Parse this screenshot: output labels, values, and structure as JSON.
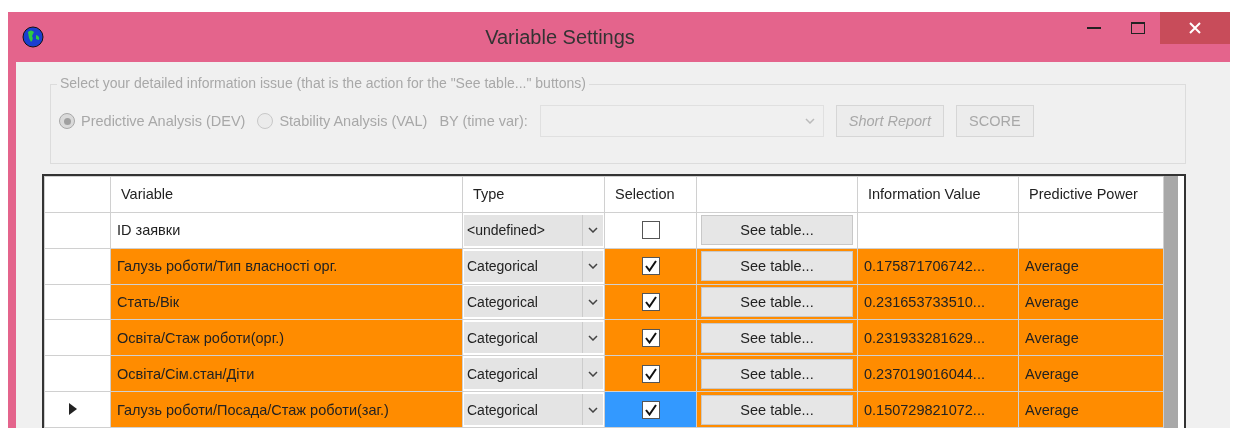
{
  "window": {
    "title": "Variable Settings"
  },
  "options": {
    "legend": "Select your detailed information issue (that is the action for the \"See table...\" buttons)",
    "radios": [
      {
        "label": "Predictive Analysis (DEV)",
        "selected": true
      },
      {
        "label": "Stability Analysis (VAL)",
        "selected": false
      }
    ],
    "by_label": "BY (time var):",
    "disabled": true,
    "buttons": [
      "Short Report",
      "SCORE"
    ]
  },
  "table": {
    "columns": [
      "Variable",
      "Type",
      "Selection",
      "Information Value",
      "Predictive Power"
    ],
    "rows": [
      {
        "variable": "ID заявки",
        "type": "<undefined>",
        "checked": false,
        "button": "See table...",
        "information_value": "",
        "predictive_power": "",
        "highlighted": false,
        "current": false
      },
      {
        "variable": "Галузь роботи/Тип власності орг.",
        "type": "Categorical",
        "checked": true,
        "button": "See table...",
        "information_value": "0.175871706742...",
        "predictive_power": "Average",
        "highlighted": true,
        "current": false
      },
      {
        "variable": "Стать/Вік",
        "type": "Categorical",
        "checked": true,
        "button": "See table...",
        "information_value": "0.231653733510...",
        "predictive_power": "Average",
        "highlighted": true,
        "current": false
      },
      {
        "variable": "Освіта/Стаж роботи(орг.)",
        "type": "Categorical",
        "checked": true,
        "button": "See table...",
        "information_value": "0.231933281629...",
        "predictive_power": "Average",
        "highlighted": true,
        "current": false
      },
      {
        "variable": "Освіта/Сім.стан/Діти",
        "type": "Categorical",
        "checked": true,
        "button": "See table...",
        "information_value": "0.237019016044...",
        "predictive_power": "Average",
        "highlighted": true,
        "current": false
      },
      {
        "variable": "Галузь роботи/Посада/Стаж роботи(заг.)",
        "type": "Categorical",
        "checked": true,
        "button": "See table...",
        "information_value": "0.150729821072...",
        "predictive_power": "Average",
        "highlighted": true,
        "current": true
      }
    ]
  }
}
